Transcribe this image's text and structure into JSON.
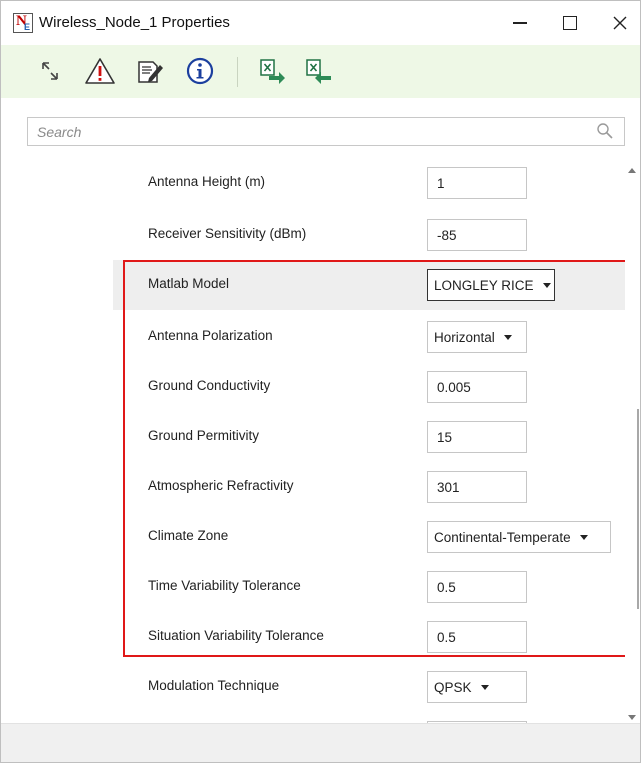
{
  "window": {
    "title": "Wireless_Node_1 Properties",
    "app_icon_text": "N",
    "app_icon_sub": "E"
  },
  "toolbar": {
    "buttons": [
      {
        "icon": "expand-arrows-icon"
      },
      {
        "icon": "warning-icon"
      },
      {
        "icon": "edit-document-icon"
      },
      {
        "icon": "info-icon"
      },
      {
        "icon": "excel-export-icon"
      },
      {
        "icon": "excel-import-icon"
      }
    ]
  },
  "search": {
    "placeholder": "Search",
    "value": ""
  },
  "properties": [
    {
      "label": "Antenna Height (m)",
      "value": "1",
      "type": "text"
    },
    {
      "label": "Receiver Sensitivity (dBm)",
      "value": "-85",
      "type": "text"
    },
    {
      "label": "Matlab Model",
      "value": "LONGLEY RICE",
      "type": "dropdown"
    },
    {
      "label": "Antenna Polarization",
      "value": "Horizontal",
      "type": "dropdown"
    },
    {
      "label": "Ground Conductivity",
      "value": "0.005",
      "type": "text"
    },
    {
      "label": "Ground Permitivity",
      "value": "15",
      "type": "text"
    },
    {
      "label": "Atmospheric Refractivity",
      "value": "301",
      "type": "text"
    },
    {
      "label": "Climate Zone",
      "value": "Continental-Temperate",
      "type": "dropdown"
    },
    {
      "label": "Time Variability Tolerance",
      "value": "0.5",
      "type": "text"
    },
    {
      "label": "Situation Variability Tolerance",
      "value": "0.5",
      "type": "text"
    },
    {
      "label": "Modulation Technique",
      "value": "QPSK",
      "type": "dropdown"
    }
  ],
  "colors": {
    "highlight_border": "#e01818",
    "toolbar_bg": "#eef8e6",
    "selected_row_bg": "#eeeeee"
  }
}
